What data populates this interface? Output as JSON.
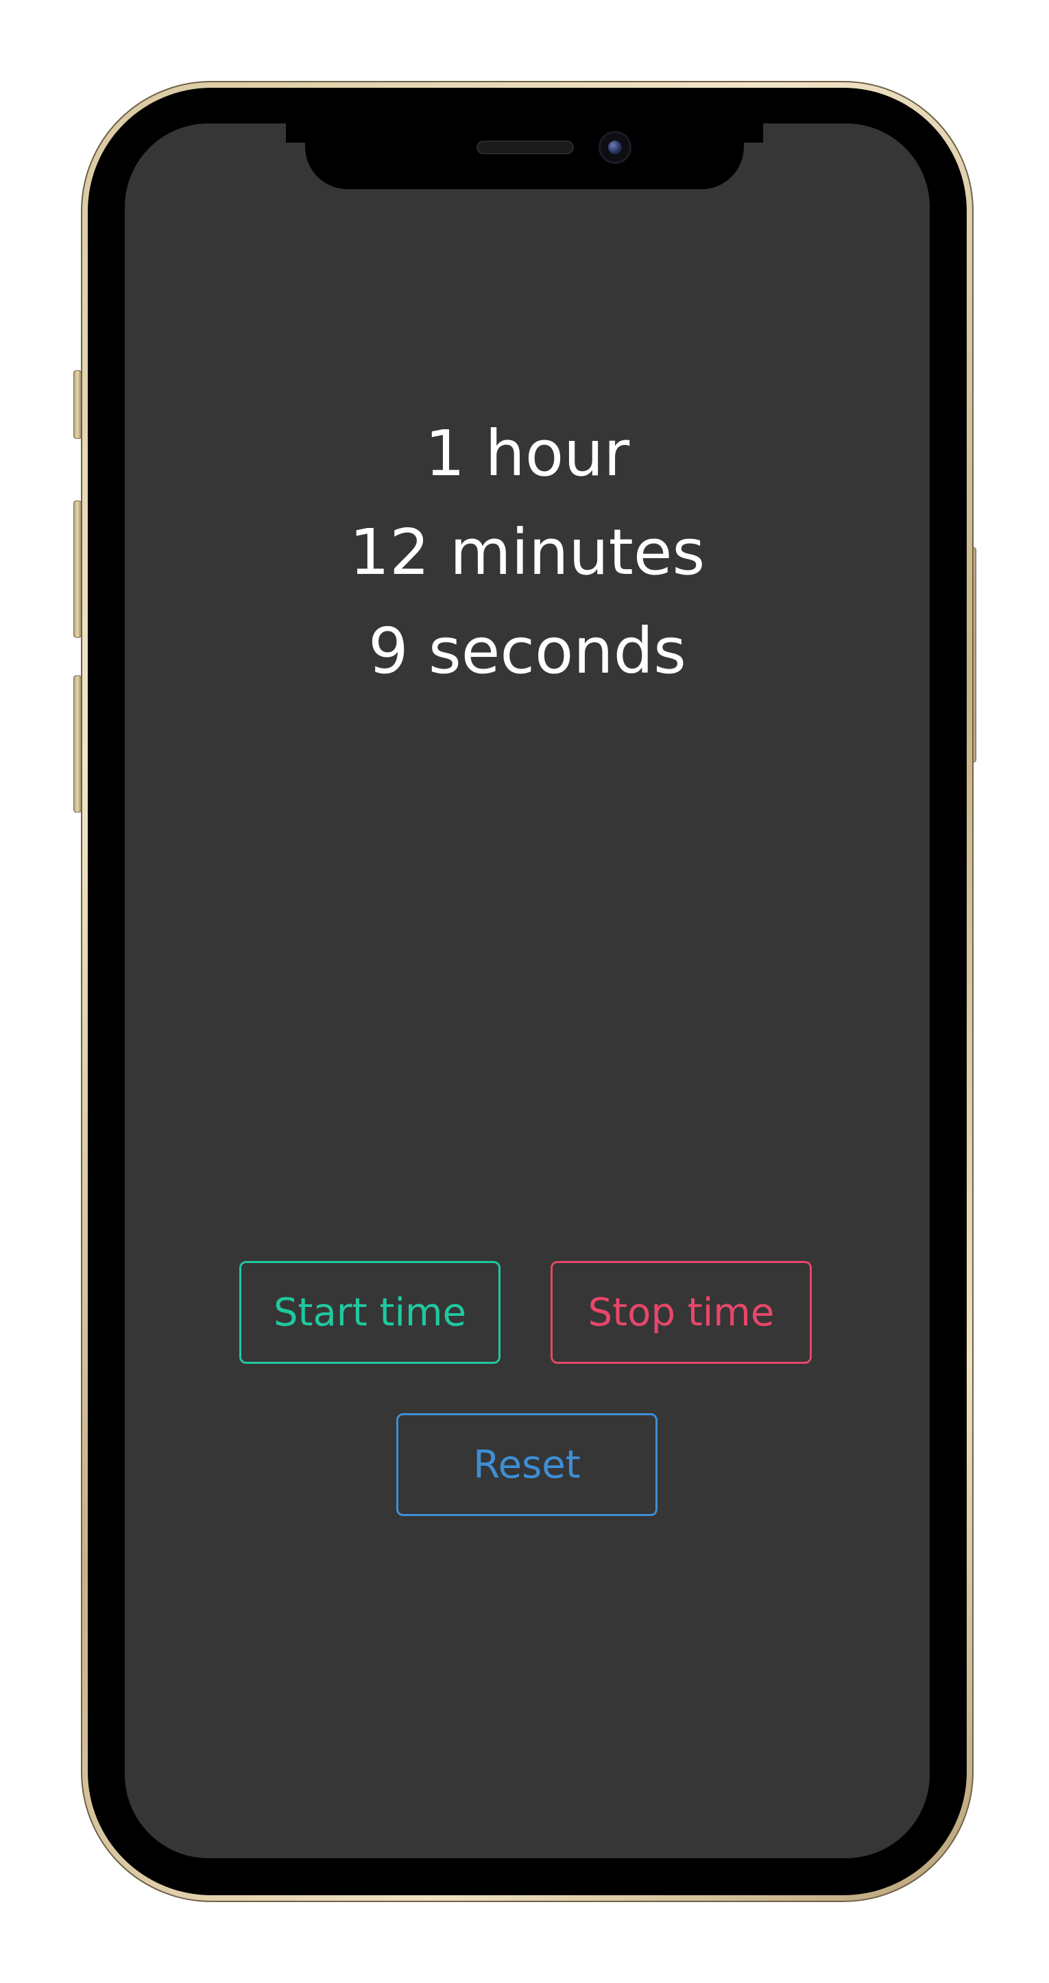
{
  "timer": {
    "hours_text": "1 hour",
    "minutes_text": "12 minutes",
    "seconds_text": "9 seconds"
  },
  "controls": {
    "start_label": "Start time",
    "stop_label": "Stop time",
    "reset_label": "Reset"
  },
  "colors": {
    "screen_background": "#363636",
    "text": "#ffffff",
    "start_accent": "#1fc99f",
    "stop_accent": "#e8466a",
    "reset_accent": "#3d8fd6",
    "frame": "#d9c8a0"
  }
}
